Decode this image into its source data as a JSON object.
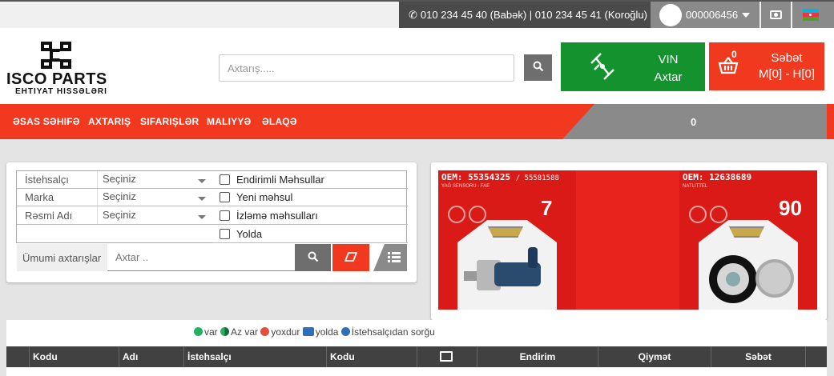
{
  "topbar": {
    "phones": "010 234 45 40 (Babək) | 010 234 45 41 (Koroğlu)",
    "account_number": "000006456"
  },
  "header": {
    "logo_title": "ISCO PARTS",
    "logo_subtitle": "EHTIYAT HISSƏLƏRI",
    "search_placeholder": "Axtarış.....",
    "vin_line1": "VIN",
    "vin_line2": "Axtar",
    "cart_count": "0",
    "cart_line1": "Səbət",
    "cart_line2": "M[0] - H[0]"
  },
  "nav": {
    "items": [
      "ƏSAS SƏHIFƏ",
      "AXTARIŞ",
      "SIFARIŞLƏR",
      "MALIYYƏ",
      "ƏLAQƏ"
    ],
    "right_count": "0"
  },
  "filters": {
    "rows": [
      {
        "label": "İstehsalçı",
        "value": "Seçiniz"
      },
      {
        "label": "Marka",
        "value": "Seçiniz"
      },
      {
        "label": "Rəsmi Adı",
        "value": "Seçiniz"
      }
    ],
    "checkboxes": [
      "Endirimli Məhsullar",
      "Yeni məhsul",
      "İzləmə məhsulları",
      "Yolda"
    ],
    "general_label": "Ümumi axtarışlar",
    "general_placeholder": "Axtar .."
  },
  "banner": {
    "products": [
      {
        "oem": "OEM: 55354325",
        "oem_alt": "/ 55581588",
        "desc": "YAĞ SENSORU - FAE",
        "qty": "7"
      },
      {
        "oem": "OEM: 12638689",
        "oem_alt": "",
        "desc": "NATLITTEL",
        "qty": "90"
      }
    ]
  },
  "legend": {
    "var": "var",
    "az_var": "Az var",
    "yoxdur": "yoxdur",
    "yolda": "yolda",
    "sorgu": "İstehsalçıdan sorğu"
  },
  "table": {
    "headers": [
      "Kodu",
      "Adı",
      "İstehsalçı",
      "Kodu",
      "",
      "Endirim",
      "Qiymət",
      "Səbət"
    ]
  },
  "colors": {
    "brand_red": "#f0391f",
    "vin_green": "#14922e",
    "dark_grey": "#4a4a4a",
    "mid_grey": "#8a8a8a"
  }
}
